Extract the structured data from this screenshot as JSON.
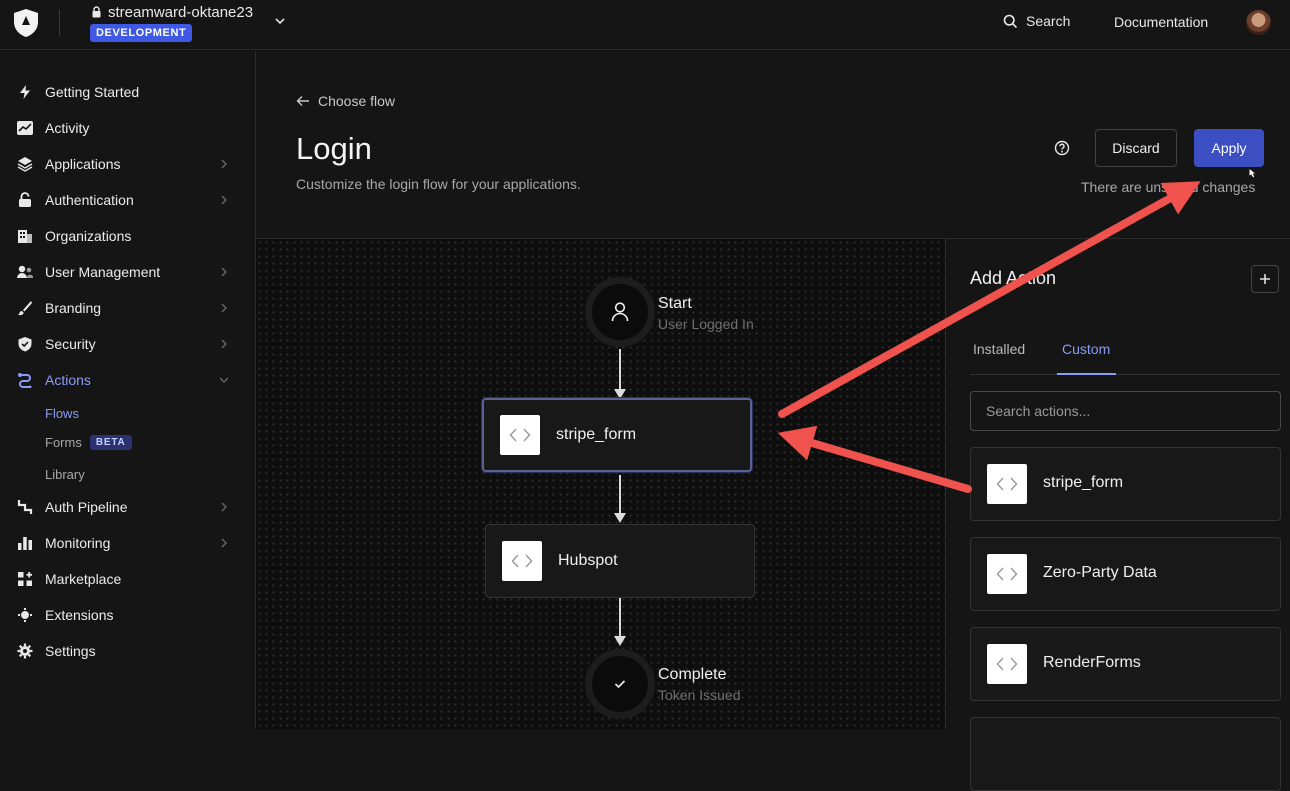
{
  "topbar": {
    "tenant_name": "streamward-oktane23",
    "environment": "DEVELOPMENT",
    "search_label": "Search",
    "docs_label": "Documentation"
  },
  "sidebar": {
    "items": [
      {
        "label": "Getting Started",
        "icon": "bolt-icon"
      },
      {
        "label": "Activity",
        "icon": "activity-chart-icon"
      },
      {
        "label": "Applications",
        "icon": "layers-icon"
      },
      {
        "label": "Authentication",
        "icon": "lock-icon"
      },
      {
        "label": "Organizations",
        "icon": "building-icon"
      },
      {
        "label": "User Management",
        "icon": "users-icon"
      },
      {
        "label": "Branding",
        "icon": "brush-icon"
      },
      {
        "label": "Security",
        "icon": "shield-icon"
      },
      {
        "label": "Actions",
        "icon": "actions-icon"
      },
      {
        "label": "Auth Pipeline",
        "icon": "pipeline-icon"
      },
      {
        "label": "Monitoring",
        "icon": "bar-chart-icon"
      },
      {
        "label": "Marketplace",
        "icon": "marketplace-icon"
      },
      {
        "label": "Extensions",
        "icon": "extensions-icon"
      },
      {
        "label": "Settings",
        "icon": "gear-icon"
      }
    ],
    "actions_sub": {
      "flows": "Flows",
      "forms": "Forms",
      "forms_badge": "BETA",
      "library": "Library"
    }
  },
  "header": {
    "back_label": "Choose flow",
    "title": "Login",
    "subtitle": "Customize the login flow for your applications.",
    "discard_label": "Discard",
    "apply_label": "Apply",
    "unsaved_text": "There are unsaved changes"
  },
  "flow": {
    "start_label": "Start",
    "start_sub": "User Logged In",
    "actions": [
      "stripe_form",
      "Hubspot"
    ],
    "end_label": "Complete",
    "end_sub": "Token Issued"
  },
  "panel": {
    "title": "Add Action",
    "tabs": [
      "Installed",
      "Custom"
    ],
    "active_tab": "Custom",
    "search_placeholder": "Search actions...",
    "cards": [
      "stripe_form",
      "Zero-Party Data",
      "RenderForms"
    ]
  },
  "colors": {
    "accent": "#3c4fc2",
    "active_link": "#8a9cf6",
    "annotation_arrow": "#f0524d",
    "badge_dev": "#3f59e4"
  }
}
